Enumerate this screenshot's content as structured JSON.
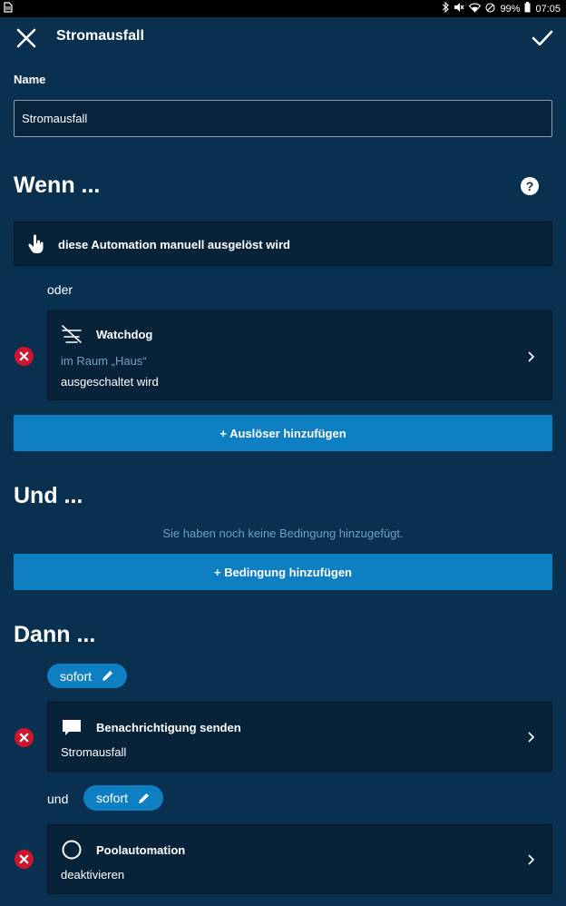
{
  "statusbar": {
    "battery": "99%",
    "time": "07:05"
  },
  "header": {
    "title": "Stromausfall"
  },
  "name_field": {
    "label": "Name",
    "value": "Stromausfall"
  },
  "when": {
    "title": "Wenn ...",
    "manual_trigger": "diese Automation manuell ausgelöst wird",
    "connector": "oder",
    "trigger": {
      "title": "Watchdog",
      "room": "im Raum „Haus“",
      "state": "ausgeschaltet wird"
    },
    "add_button": "+ Auslöser hinzufügen"
  },
  "and": {
    "title": "Und ...",
    "empty_text": "Sie haben noch keine Bedingung hinzugefügt.",
    "add_button": "+ Bedingung hinzufügen"
  },
  "then": {
    "title": "Dann ...",
    "timing1": "sofort",
    "action1": {
      "title": "Benachrichtigung senden",
      "sub": "Stromausfall"
    },
    "connector": "und",
    "timing2": "sofort",
    "action2": {
      "title": "Poolautomation",
      "sub": "deaktivieren"
    }
  },
  "colors": {
    "background": "#0a3050",
    "card": "#08223a",
    "primary": "#0f7fc4",
    "danger": "#d0142b",
    "muted": "#6fa0c4"
  },
  "icons": [
    "sim-icon",
    "bluetooth-icon",
    "mute-icon",
    "wifi-icon",
    "dnd-icon",
    "battery-icon",
    "close-icon",
    "check-icon",
    "help-icon",
    "hand-pointer-icon",
    "watchdog-icon",
    "remove-icon",
    "chevron-right-icon",
    "pencil-icon",
    "message-icon",
    "circle-icon"
  ]
}
